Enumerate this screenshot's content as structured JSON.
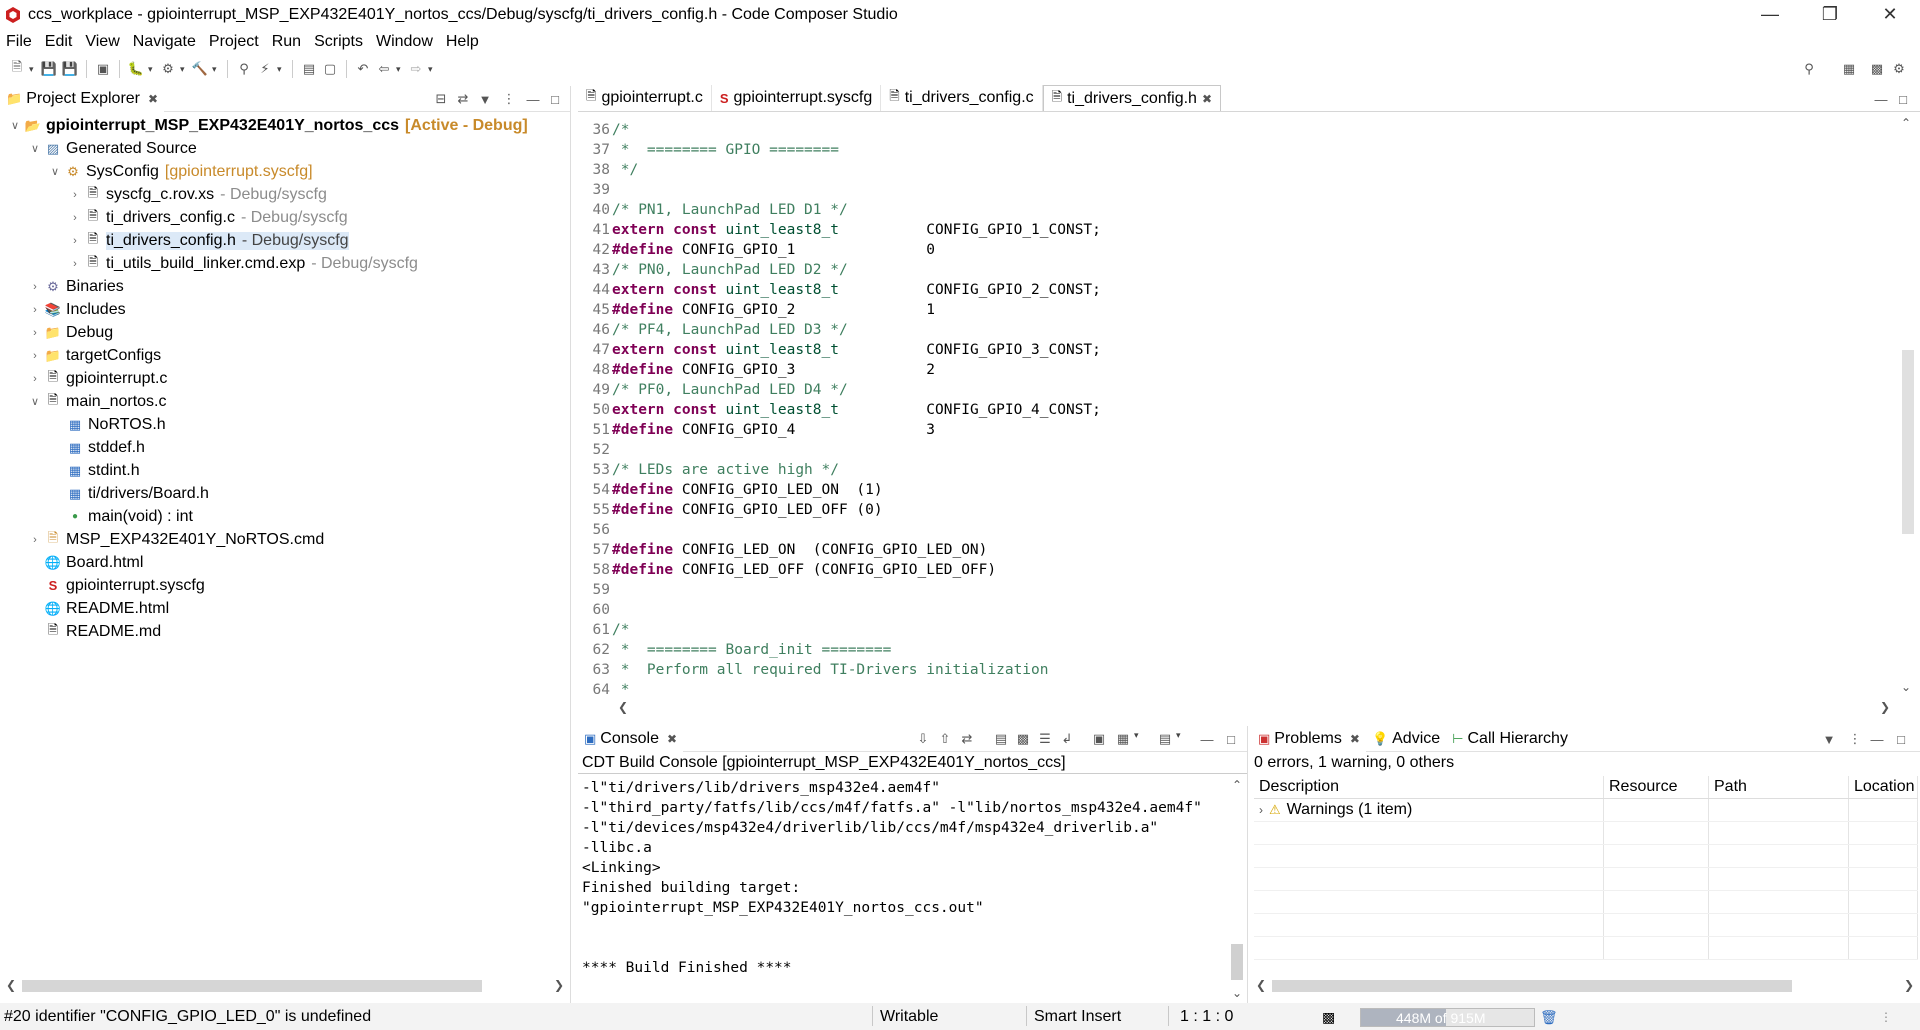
{
  "window": {
    "title": "ccs_workplace - gpiointerrupt_MSP_EXP432E401Y_nortos_ccs/Debug/syscfg/ti_drivers_config.h - Code Composer Studio"
  },
  "menu": [
    "File",
    "Edit",
    "View",
    "Navigate",
    "Project",
    "Run",
    "Scripts",
    "Window",
    "Help"
  ],
  "explorer": {
    "tab_label": "Project Explorer",
    "project_name": "gpiointerrupt_MSP_EXP432E401Y_nortos_ccs",
    "project_tag": "[Active - Debug]",
    "generated_source": "Generated Source",
    "sysconfig": "SysConfig",
    "sysconfig_tag": "[gpiointerrupt.syscfg]",
    "gen_files": [
      {
        "name": "syscfg_c.rov.xs",
        "deco": "- Debug/syscfg"
      },
      {
        "name": "ti_drivers_config.c",
        "deco": "- Debug/syscfg"
      },
      {
        "name": "ti_drivers_config.h",
        "deco": "- Debug/syscfg"
      },
      {
        "name": "ti_utils_build_linker.cmd.exp",
        "deco": "- Debug/syscfg"
      }
    ],
    "folders": [
      "Binaries",
      "Includes",
      "Debug",
      "targetConfigs"
    ],
    "gpiointerrupt_c": "gpiointerrupt.c",
    "main_nortos": "main_nortos.c",
    "main_children": [
      "NoRTOS.h",
      "stddef.h",
      "stdint.h",
      "ti/drivers/Board.h",
      "main(void) : int"
    ],
    "tail_files": [
      "MSP_EXP432E401Y_NoRTOS.cmd",
      "Board.html",
      "gpiointerrupt.syscfg",
      "README.html",
      "README.md"
    ]
  },
  "editor": {
    "tabs": [
      "gpiointerrupt.c",
      "gpiointerrupt.syscfg",
      "ti_drivers_config.c",
      "ti_drivers_config.h"
    ],
    "lines": [
      {
        "n": "36",
        "parts": [
          {
            "t": "/*",
            "c": "cc"
          }
        ]
      },
      {
        "n": "37",
        "parts": [
          {
            "t": " *  ======== GPIO ========",
            "c": "cc"
          }
        ]
      },
      {
        "n": "38",
        "parts": [
          {
            "t": " */",
            "c": "cc"
          }
        ]
      },
      {
        "n": "39",
        "parts": []
      },
      {
        "n": "40",
        "parts": [
          {
            "t": "/* PN1, LaunchPad LED D1 */",
            "c": "cc"
          }
        ]
      },
      {
        "n": "41",
        "parts": [
          {
            "t": "extern const ",
            "c": "kw"
          },
          {
            "t": "uint_least8_t",
            "c": "dt"
          },
          {
            "t": "          CONFIG_GPIO_1_CONST;",
            "c": ""
          }
        ]
      },
      {
        "n": "42",
        "parts": [
          {
            "t": "#define",
            "c": "kw"
          },
          {
            "t": " CONFIG_GPIO_1               0",
            "c": ""
          }
        ]
      },
      {
        "n": "43",
        "parts": [
          {
            "t": "/* PN0, LaunchPad LED D2 */",
            "c": "cc"
          }
        ]
      },
      {
        "n": "44",
        "parts": [
          {
            "t": "extern const ",
            "c": "kw"
          },
          {
            "t": "uint_least8_t",
            "c": "dt"
          },
          {
            "t": "          CONFIG_GPIO_2_CONST;",
            "c": ""
          }
        ]
      },
      {
        "n": "45",
        "parts": [
          {
            "t": "#define",
            "c": "kw"
          },
          {
            "t": " CONFIG_GPIO_2               1",
            "c": ""
          }
        ]
      },
      {
        "n": "46",
        "parts": [
          {
            "t": "/* PF4, LaunchPad LED D3 */",
            "c": "cc"
          }
        ]
      },
      {
        "n": "47",
        "parts": [
          {
            "t": "extern const ",
            "c": "kw"
          },
          {
            "t": "uint_least8_t",
            "c": "dt"
          },
          {
            "t": "          CONFIG_GPIO_3_CONST;",
            "c": ""
          }
        ]
      },
      {
        "n": "48",
        "parts": [
          {
            "t": "#define",
            "c": "kw"
          },
          {
            "t": " CONFIG_GPIO_3               2",
            "c": ""
          }
        ]
      },
      {
        "n": "49",
        "parts": [
          {
            "t": "/* PF0, LaunchPad LED D4 */",
            "c": "cc"
          }
        ]
      },
      {
        "n": "50",
        "parts": [
          {
            "t": "extern const ",
            "c": "kw"
          },
          {
            "t": "uint_least8_t",
            "c": "dt"
          },
          {
            "t": "          CONFIG_GPIO_4_CONST;",
            "c": ""
          }
        ]
      },
      {
        "n": "51",
        "parts": [
          {
            "t": "#define",
            "c": "kw"
          },
          {
            "t": " CONFIG_GPIO_4               3",
            "c": ""
          }
        ]
      },
      {
        "n": "52",
        "parts": []
      },
      {
        "n": "53",
        "parts": [
          {
            "t": "/* LEDs are active high */",
            "c": "cc"
          }
        ]
      },
      {
        "n": "54",
        "parts": [
          {
            "t": "#define",
            "c": "kw"
          },
          {
            "t": " CONFIG_GPIO_LED_ON  (1)",
            "c": ""
          }
        ]
      },
      {
        "n": "55",
        "parts": [
          {
            "t": "#define",
            "c": "kw"
          },
          {
            "t": " CONFIG_GPIO_LED_OFF (0)",
            "c": ""
          }
        ]
      },
      {
        "n": "56",
        "parts": []
      },
      {
        "n": "57",
        "parts": [
          {
            "t": "#define",
            "c": "kw"
          },
          {
            "t": " CONFIG_LED_ON  (CONFIG_GPIO_LED_ON)",
            "c": ""
          }
        ]
      },
      {
        "n": "58",
        "parts": [
          {
            "t": "#define",
            "c": "kw"
          },
          {
            "t": " CONFIG_LED_OFF (CONFIG_GPIO_LED_OFF)",
            "c": ""
          }
        ]
      },
      {
        "n": "59",
        "parts": []
      },
      {
        "n": "60",
        "parts": []
      },
      {
        "n": "61",
        "parts": [
          {
            "t": "/*",
            "c": "cc"
          }
        ]
      },
      {
        "n": "62",
        "parts": [
          {
            "t": " *  ======== Board_init ========",
            "c": "cc"
          }
        ]
      },
      {
        "n": "63",
        "parts": [
          {
            "t": " *  Perform all required TI-Drivers initialization",
            "c": "cc"
          }
        ]
      },
      {
        "n": "64",
        "parts": [
          {
            "t": " *",
            "c": "cc"
          }
        ]
      }
    ]
  },
  "console": {
    "tab_label": "Console",
    "header": "CDT Build Console [gpiointerrupt_MSP_EXP432E401Y_nortos_ccs]",
    "lines": [
      "-l\"ti/drivers/lib/drivers_msp432e4.aem4f\"",
      "-l\"third_party/fatfs/lib/ccs/m4f/fatfs.a\" -l\"lib/nortos_msp432e4.aem4f\"",
      "-l\"ti/devices/msp432e4/driverlib/lib/ccs/m4f/msp432e4_driverlib.a\"",
      "-llibc.a",
      "<Linking>",
      "Finished building target:",
      "\"gpiointerrupt_MSP_EXP432E401Y_nortos_ccs.out\"",
      "",
      "",
      "**** Build Finished ****"
    ]
  },
  "problems": {
    "tabs": [
      "Problems",
      "Advice",
      "Call Hierarchy"
    ],
    "summary": "0 errors, 1 warning, 0 others",
    "columns": [
      "Description",
      "Resource",
      "Path",
      "Location"
    ],
    "warnings_row": "Warnings (1 item)"
  },
  "status": {
    "message": "#20 identifier \"CONFIG_GPIO_LED_0\" is undefined",
    "writable": "Writable",
    "insert_mode": "Smart Insert",
    "position": "1 : 1 : 0",
    "heap": "448M of 915M",
    "heap_fraction": 0.49
  }
}
